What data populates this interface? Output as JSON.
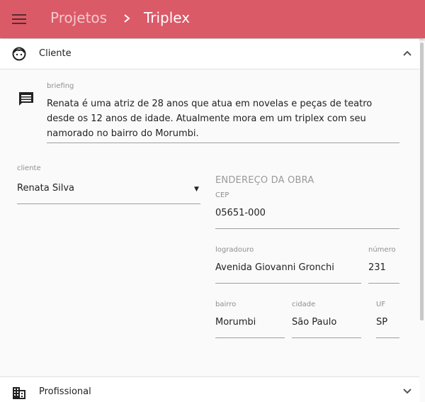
{
  "header": {
    "breadcrumb_parent": "Projetos",
    "breadcrumb_current": "Triplex",
    "color": "#db5a68"
  },
  "panels": {
    "cliente": {
      "title": "Cliente",
      "icon": "face-icon",
      "state": "expanded"
    },
    "profissional": {
      "title": "Profissional",
      "icon": "business-icon",
      "state": "collapsed"
    }
  },
  "briefing": {
    "label": "briefing",
    "text": "Renata é uma atriz de 28 anos que atua em novelas e peças de teatro desde os 12 anos de idade. Atualmente mora em um triplex com seu namorado no bairro do Morumbi."
  },
  "cliente": {
    "label": "cliente",
    "value": "Renata Silva",
    "arrow": "▼"
  },
  "endereco": {
    "section_title": "ENDEREÇO DA OBRA",
    "cep": {
      "label": "CEP",
      "value": "05651-000"
    },
    "logradouro": {
      "label": "logradouro",
      "value": "Avenida Giovanni Gronchi"
    },
    "numero": {
      "label": "número",
      "value": "231"
    },
    "bairro": {
      "label": "bairro",
      "value": "Morumbi"
    },
    "cidade": {
      "label": "cidade",
      "value": "São Paulo"
    },
    "uf": {
      "label": "UF",
      "value": "SP"
    }
  }
}
